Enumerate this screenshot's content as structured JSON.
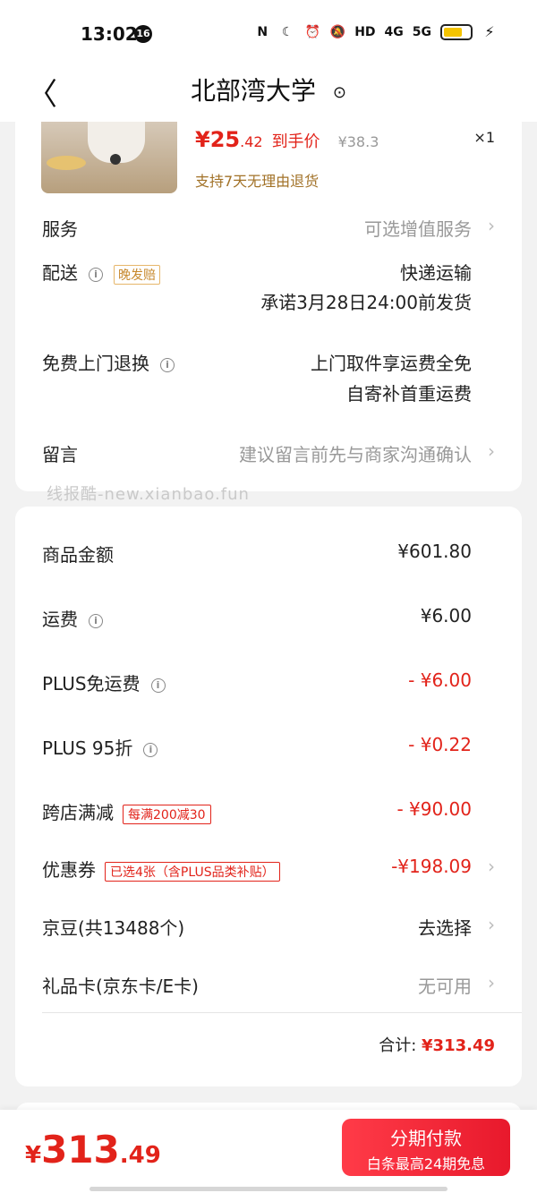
{
  "status_bar": {
    "time": "13:02",
    "badge": "16",
    "nfc": "N",
    "moon": "☾",
    "alarm": "⏰",
    "mute": "🔕",
    "hd": "HD",
    "net4g": "4G",
    "net5g": "5G"
  },
  "nav": {
    "back": "〈",
    "title": "北部湾大学",
    "pin": "⊙"
  },
  "product": {
    "price_currency": "¥",
    "price_int": "25",
    "price_dec": ".42",
    "price_tag": "到手价",
    "orig_price": "¥38.3",
    "qty": "×1",
    "return_policy": "支持7天无理由退货"
  },
  "order": {
    "service_label": "服务",
    "service_value": "可选增值服务",
    "delivery_label": "配送",
    "delivery_tag": "晚发赔",
    "delivery_method": "快递运输",
    "delivery_promise": "承诺3月28日24:00前发货",
    "return_label": "免费上门退换",
    "return_line1": "上门取件享运费全免",
    "return_line2": "自寄补首重运费",
    "message_label": "留言",
    "message_placeholder": "建议留言前先与商家沟通确认"
  },
  "watermark": "线报酷-new.xianbao.fun",
  "summary": {
    "goods_label": "商品金额",
    "goods_value": "¥601.80",
    "shipping_label": "运费",
    "shipping_value": "¥6.00",
    "plus_ship_label": "PLUS免运费",
    "plus_ship_value": "- ¥6.00",
    "plus95_label": "PLUS 95折",
    "plus95_value": "- ¥0.22",
    "cross_label": "跨店满减",
    "cross_tag": "每满200减30",
    "cross_value": "- ¥90.00",
    "coupon_label": "优惠券",
    "coupon_tag": "已选4张（含PLUS品类补贴）",
    "coupon_value": "-¥198.09",
    "jd_bean_label": "京豆(共13488个)",
    "jd_bean_value": "去选择",
    "gift_label": "礼品卡(京东卡/E卡)",
    "gift_value": "无可用",
    "total_label": "合计:",
    "total_value": "¥313.49"
  },
  "bottom": {
    "currency": "¥",
    "int": "313",
    "dec": ".49",
    "pay_main": "分期付款",
    "pay_sub": "白条最高24期免息"
  },
  "colors": {
    "accent": "#e2231a",
    "tag_orange": "#c7892e",
    "return_text": "#a27228"
  },
  "icons": {
    "info": "ⓘ",
    "chevron": "›"
  }
}
